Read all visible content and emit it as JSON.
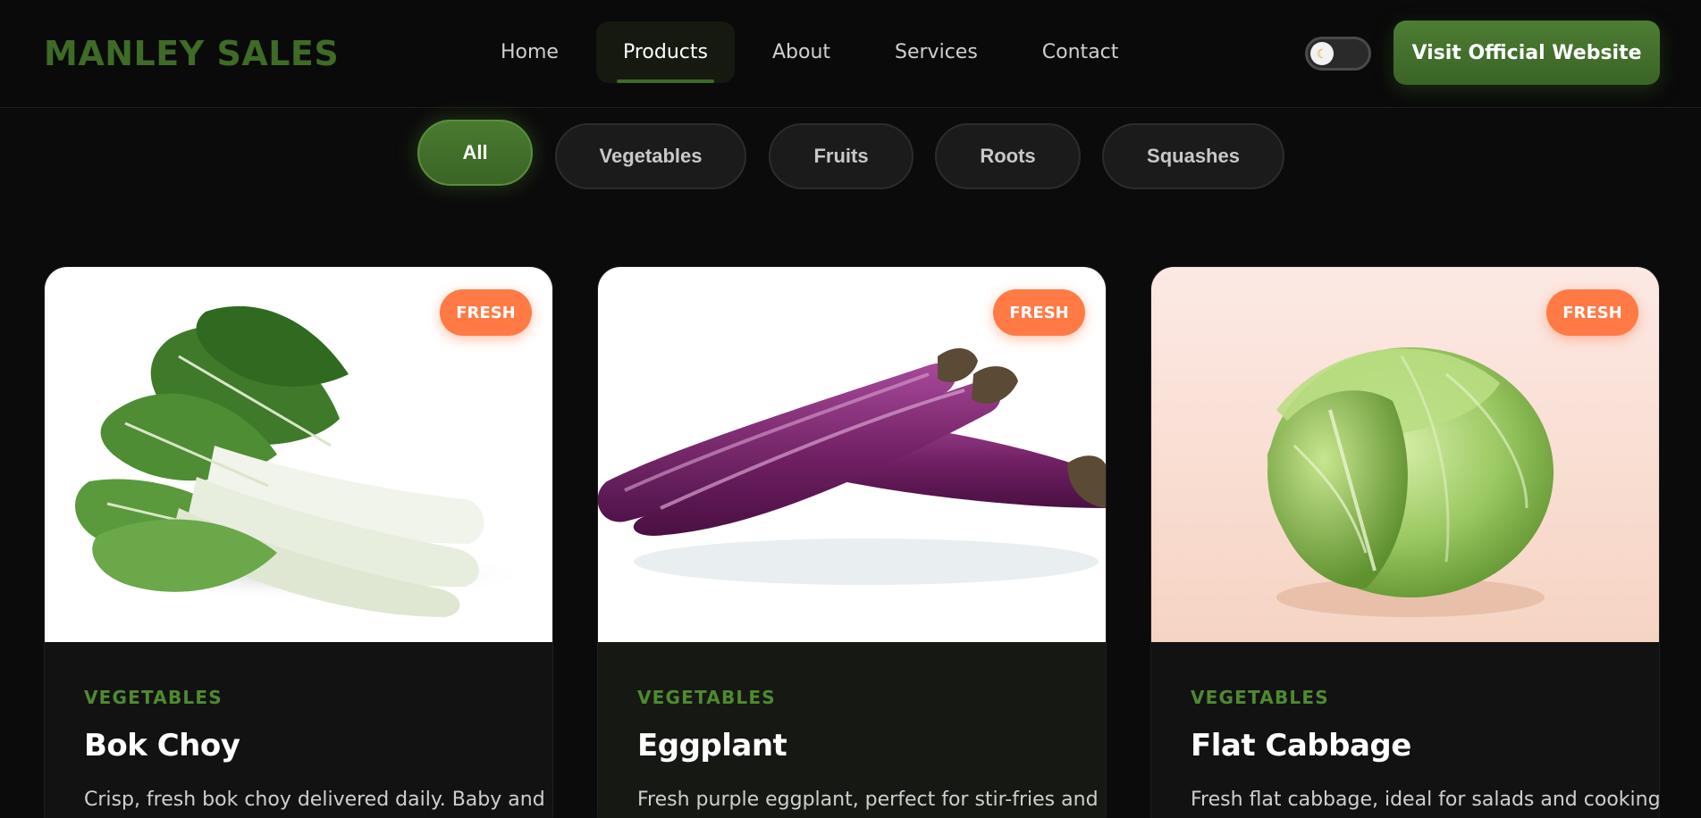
{
  "header": {
    "logo": "MANLEY SALES",
    "nav": [
      {
        "label": "Home",
        "active": false
      },
      {
        "label": "Products",
        "active": true
      },
      {
        "label": "About",
        "active": false
      },
      {
        "label": "Services",
        "active": false
      },
      {
        "label": "Contact",
        "active": false
      }
    ],
    "theme_toggle_icon": "moon-icon",
    "cta_label": "Visit Official Website"
  },
  "filters": [
    {
      "label": "All",
      "active": true
    },
    {
      "label": "Vegetables",
      "active": false
    },
    {
      "label": "Fruits",
      "active": false
    },
    {
      "label": "Roots",
      "active": false
    },
    {
      "label": "Squashes",
      "active": false
    }
  ],
  "products": [
    {
      "badge": "FRESH",
      "category": "VEGETABLES",
      "name": "Bok Choy",
      "description": "Crisp, fresh bok choy delivered daily. Baby and",
      "image_icon": "bok-choy-image"
    },
    {
      "badge": "FRESH",
      "category": "VEGETABLES",
      "name": "Eggplant",
      "description": "Fresh purple eggplant, perfect for stir-fries and",
      "image_icon": "eggplant-image"
    },
    {
      "badge": "FRESH",
      "category": "VEGETABLES",
      "name": "Flat Cabbage",
      "description": "Fresh flat cabbage, ideal for salads and cooking.",
      "image_icon": "cabbage-image"
    }
  ],
  "colors": {
    "brand_green": "#3e6b26",
    "accent_orange": "#ff7a45",
    "background": "#0b0b0b"
  }
}
